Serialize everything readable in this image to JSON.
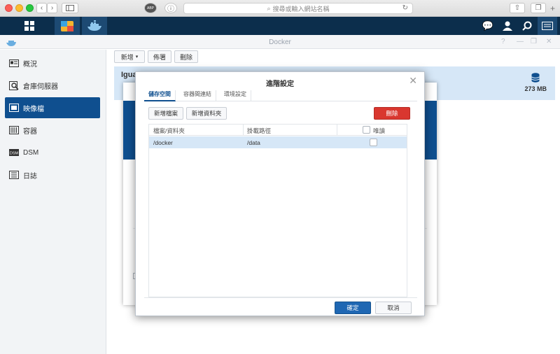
{
  "browser": {
    "url_placeholder": "搜尋或輸入網站名稱",
    "adblock_label": "ABP"
  },
  "window": {
    "title": "Docker"
  },
  "sidebar": {
    "items": [
      {
        "label": "概況",
        "icon": "overview-icon"
      },
      {
        "label": "倉庫伺服器",
        "icon": "registry-icon"
      },
      {
        "label": "映像檔",
        "icon": "image-icon",
        "active": true
      },
      {
        "label": "容器",
        "icon": "container-icon"
      },
      {
        "label": "DSM",
        "icon": "dsm-icon"
      },
      {
        "label": "日誌",
        "icon": "log-icon"
      }
    ]
  },
  "toolbar": {
    "add_label": "新增",
    "deploy_label": "佈署",
    "delete_label": "刪除"
  },
  "image_row": {
    "name": "Igua",
    "size": "273 MB"
  },
  "dialog": {
    "title": "進階設定",
    "tabs": [
      "儲存空間",
      "容器間連結",
      "環境設定"
    ],
    "add_file_label": "新增檔案",
    "add_folder_label": "新增資料夾",
    "delete_label": "刪除",
    "columns": [
      "檔案/資料夾",
      "掛載路徑",
      "唯讀"
    ],
    "rows": [
      {
        "path": "/docker",
        "mount": "/data",
        "readonly": false
      }
    ],
    "ok_label": "確定",
    "cancel_label": "取消"
  },
  "colors": {
    "accent": "#0f4f8f",
    "danger": "#d9372f",
    "topbar": "#0c2e4c",
    "selection": "#d6e7f7"
  }
}
